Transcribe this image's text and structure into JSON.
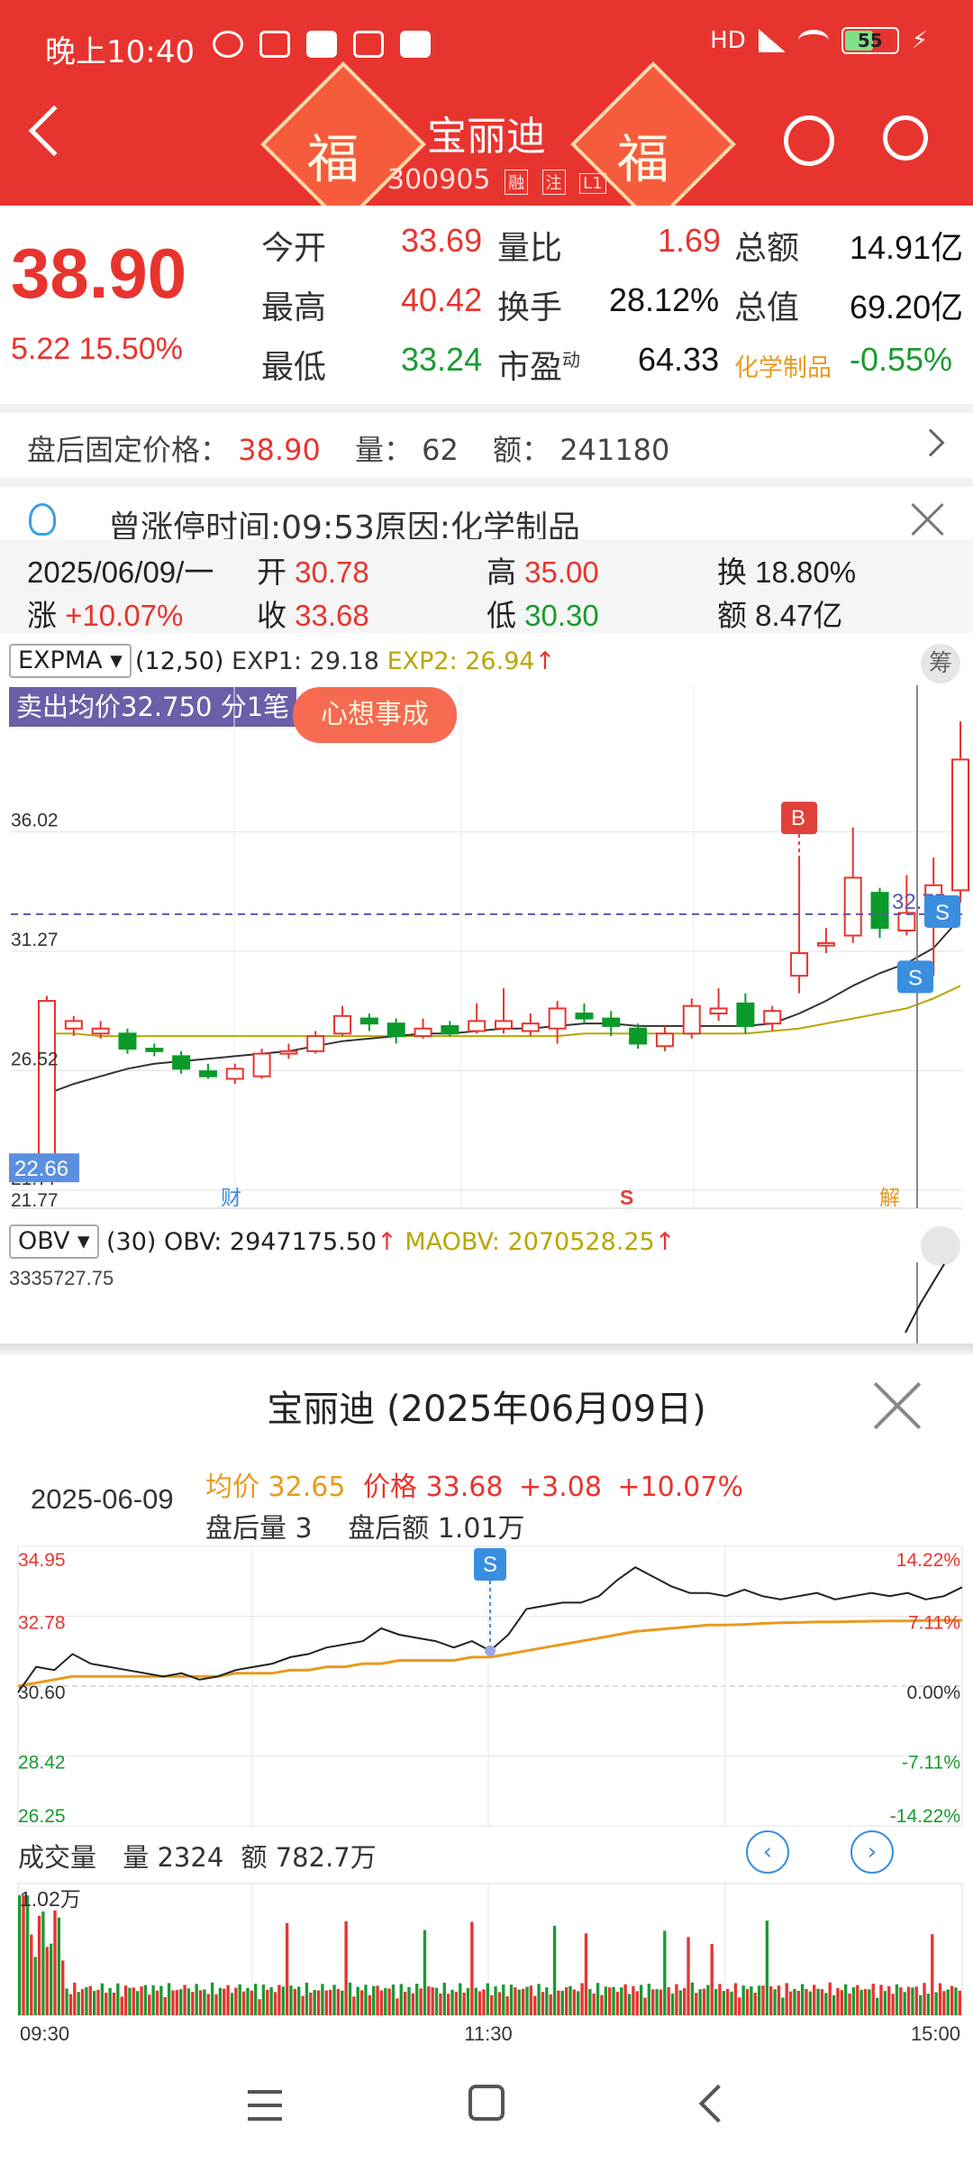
{
  "status_bar": {
    "time": "晚上10:40",
    "network": "HD",
    "battery": "55",
    "battery_level": 0.55
  },
  "header": {
    "stock_name": "宝丽迪",
    "stock_code": "300905",
    "tags": [
      "融",
      "注",
      "L1"
    ],
    "fu_char": "福",
    "bg_color": "#e8342e"
  },
  "quote": {
    "price": "38.90",
    "change": "5.22",
    "change_pct": "15.50%",
    "stats": [
      {
        "label": "今开",
        "value": "33.69"
      },
      {
        "label": "最高",
        "value": "40.42"
      },
      {
        "label": "最低",
        "value": "33.24"
      },
      {
        "label": "量比",
        "value": "1.69"
      },
      {
        "label": "换手",
        "value": "28.12%"
      },
      {
        "label": "市盈",
        "sup": "动",
        "value": "64.33"
      },
      {
        "label": "总额",
        "value": "14.91亿"
      },
      {
        "label": "总值",
        "value": "69.20亿"
      },
      {
        "label": "化学制品",
        "value": "-0.55%"
      }
    ]
  },
  "after_hours": {
    "label": "盘后固定价格：",
    "price": "38.90",
    "vol_label": "量：",
    "vol": "62",
    "amt_label": "额：",
    "amt": "241180"
  },
  "notice": {
    "text": "曾涨停时间:09:53原因:化学制品"
  },
  "day_info": {
    "date": "2025/06/09/一",
    "open_label": "开",
    "open": "30.78",
    "high_label": "高",
    "high": "35.00",
    "turnover_label": "换",
    "turnover": "18.80%",
    "chg_label": "涨",
    "chg": "+10.07%",
    "close_label": "收",
    "close": "33.68",
    "low_label": "低",
    "low": "30.30",
    "amount_label": "额",
    "amount": "8.47亿"
  },
  "kline_panel": {
    "indicator": "EXPMA",
    "params": "(12,50)",
    "exp1": "EXP1: 29.18",
    "exp2": "EXP2: 26.94",
    "sell_banner": "卖出均价32.750 分1笔",
    "badge": "心想事成",
    "chou_label": "筹",
    "price_line_label": "32.75",
    "min_label": "22.66",
    "bottom_label": "21.77",
    "marker_cai": "财",
    "marker_s": "S",
    "marker_jie": "解",
    "b_label": "B",
    "s_label": "S"
  },
  "obv_panel": {
    "indicator": "OBV",
    "params": "(30)",
    "obv": "OBV: 2947175.50",
    "maobv": "MAOBV: 2070528.25",
    "top_value": "3335727.75"
  },
  "intraday": {
    "title": "宝丽迪 (2025年06月09日)",
    "date": "2025-06-09",
    "avg_label": "均价",
    "avg": "32.65",
    "price_label": "价格",
    "price": "33.68",
    "change": "+3.08",
    "change_pct": "+10.07%",
    "ah_vol_label": "盘后量",
    "ah_vol": "3",
    "ah_amt_label": "盘后额",
    "ah_amt": "1.01万",
    "volume_label": "成交量",
    "vol_label": "量",
    "vol": "2324",
    "amt_label": "额",
    "amt": "782.7万",
    "vol_max_label": "1.02万",
    "s_label": "S"
  },
  "chart_data": [
    {
      "type": "candlestick",
      "title": "",
      "y_ticks": [
        "36.02",
        "31.27",
        "26.52",
        "21.77"
      ],
      "ylim": [
        21.77,
        40.42
      ],
      "candles": [
        {
          "o": 22.8,
          "c": 29.3,
          "h": 29.5,
          "l": 22.7
        },
        {
          "o": 28.2,
          "c": 28.5,
          "h": 28.7,
          "l": 27.9
        },
        {
          "o": 28.0,
          "c": 28.2,
          "h": 28.5,
          "l": 27.8
        },
        {
          "o": 28.0,
          "c": 27.4,
          "h": 28.2,
          "l": 27.2
        },
        {
          "o": 27.4,
          "c": 27.3,
          "h": 27.6,
          "l": 27.1
        },
        {
          "o": 27.1,
          "c": 26.6,
          "h": 27.3,
          "l": 26.4
        },
        {
          "o": 26.5,
          "c": 26.3,
          "h": 26.8,
          "l": 26.2
        },
        {
          "o": 26.2,
          "c": 26.6,
          "h": 26.8,
          "l": 26.0
        },
        {
          "o": 26.3,
          "c": 27.2,
          "h": 27.4,
          "l": 26.2
        },
        {
          "o": 27.2,
          "c": 27.3,
          "h": 27.6,
          "l": 27.0
        },
        {
          "o": 27.3,
          "c": 27.9,
          "h": 28.1,
          "l": 27.2
        },
        {
          "o": 28.0,
          "c": 28.7,
          "h": 29.1,
          "l": 27.9
        },
        {
          "o": 28.6,
          "c": 28.4,
          "h": 28.8,
          "l": 28.1
        },
        {
          "o": 28.4,
          "c": 27.9,
          "h": 28.6,
          "l": 27.6
        },
        {
          "o": 27.9,
          "c": 28.2,
          "h": 28.6,
          "l": 27.8
        },
        {
          "o": 28.3,
          "c": 28.0,
          "h": 28.5,
          "l": 27.9
        },
        {
          "o": 28.1,
          "c": 28.5,
          "h": 29.2,
          "l": 28.0
        },
        {
          "o": 28.2,
          "c": 28.5,
          "h": 29.8,
          "l": 28.0
        },
        {
          "o": 28.1,
          "c": 28.4,
          "h": 28.8,
          "l": 27.9
        },
        {
          "o": 28.2,
          "c": 29.0,
          "h": 29.3,
          "l": 27.6
        },
        {
          "o": 28.8,
          "c": 28.6,
          "h": 29.2,
          "l": 28.4
        },
        {
          "o": 28.6,
          "c": 28.3,
          "h": 28.9,
          "l": 27.9
        },
        {
          "o": 28.2,
          "c": 27.6,
          "h": 28.4,
          "l": 27.4
        },
        {
          "o": 27.5,
          "c": 28.0,
          "h": 28.3,
          "l": 27.3
        },
        {
          "o": 28.0,
          "c": 29.1,
          "h": 29.4,
          "l": 27.8
        },
        {
          "o": 28.8,
          "c": 29.0,
          "h": 29.8,
          "l": 28.5
        },
        {
          "o": 29.2,
          "c": 28.3,
          "h": 29.6,
          "l": 28.0
        },
        {
          "o": 28.4,
          "c": 28.9,
          "h": 29.1,
          "l": 28.1
        },
        {
          "o": 30.3,
          "c": 31.2,
          "h": 35.0,
          "l": 29.6
        },
        {
          "o": 31.5,
          "c": 31.6,
          "h": 32.2,
          "l": 31.2
        },
        {
          "o": 31.9,
          "c": 34.2,
          "h": 36.2,
          "l": 31.6
        },
        {
          "o": 33.6,
          "c": 32.2,
          "h": 33.8,
          "l": 31.8
        },
        {
          "o": 32.1,
          "c": 32.8,
          "h": 34.3,
          "l": 31.9
        },
        {
          "o": 32.7,
          "c": 33.9,
          "h": 35.0,
          "l": 30.3
        },
        {
          "o": 33.7,
          "c": 38.9,
          "h": 40.42,
          "l": 33.2
        }
      ],
      "exp1": [
        25.6,
        26.0,
        26.3,
        26.6,
        26.8,
        26.9,
        27.0,
        27.1,
        27.2,
        27.3,
        27.5,
        27.7,
        27.8,
        27.9,
        28.0,
        28.0,
        28.1,
        28.2,
        28.2,
        28.3,
        28.4,
        28.4,
        28.3,
        28.3,
        28.3,
        28.3,
        28.3,
        28.4,
        28.8,
        29.3,
        29.9,
        30.4,
        30.8,
        31.4,
        32.6
      ],
      "exp2": [
        28.0,
        28.0,
        27.9,
        27.9,
        27.9,
        27.9,
        27.9,
        27.9,
        27.9,
        27.9,
        27.9,
        27.9,
        27.9,
        27.9,
        27.9,
        27.9,
        27.9,
        27.9,
        27.9,
        27.9,
        28.0,
        28.0,
        28.0,
        28.0,
        28.0,
        28.0,
        28.0,
        28.1,
        28.2,
        28.4,
        28.6,
        28.8,
        29.0,
        29.4,
        29.9
      ]
    },
    {
      "type": "line",
      "title": "",
      "y_ticks_left": [
        "34.95",
        "32.78",
        "30.60",
        "28.42",
        "26.25"
      ],
      "y_ticks_right": [
        "14.22%",
        "7.11%",
        "0.00%",
        "-7.11%",
        "-14.22%"
      ],
      "x_ticks": [
        "09:30",
        "11:30",
        "15:00"
      ],
      "ylim": [
        26.25,
        34.95
      ],
      "price": [
        30.4,
        31.2,
        31.1,
        31.6,
        31.3,
        31.2,
        31.1,
        31.0,
        30.9,
        31.0,
        30.8,
        30.9,
        31.1,
        31.2,
        31.3,
        31.5,
        31.6,
        31.8,
        31.9,
        32.0,
        32.4,
        32.2,
        32.1,
        32.0,
        31.8,
        32.0,
        31.7,
        32.2,
        33.0,
        33.1,
        33.2,
        33.2,
        33.4,
        33.9,
        34.3,
        34.0,
        33.7,
        33.5,
        33.5,
        33.4,
        33.6,
        33.4,
        33.3,
        33.4,
        33.5,
        33.3,
        33.4,
        33.5,
        33.4,
        33.5,
        33.3,
        33.4,
        33.68
      ],
      "avg": [
        30.6,
        30.7,
        30.8,
        30.9,
        30.9,
        30.9,
        30.9,
        30.9,
        30.9,
        30.9,
        30.9,
        30.9,
        31.0,
        31.0,
        31.0,
        31.1,
        31.1,
        31.2,
        31.2,
        31.3,
        31.3,
        31.4,
        31.4,
        31.4,
        31.4,
        31.5,
        31.5,
        31.6,
        31.7,
        31.8,
        31.9,
        32.0,
        32.1,
        32.2,
        32.3,
        32.35,
        32.4,
        32.45,
        32.5,
        32.5,
        32.52,
        32.55,
        32.57,
        32.58,
        32.6,
        32.6,
        32.61,
        32.62,
        32.63,
        32.63,
        32.64,
        32.65,
        32.65
      ]
    }
  ]
}
